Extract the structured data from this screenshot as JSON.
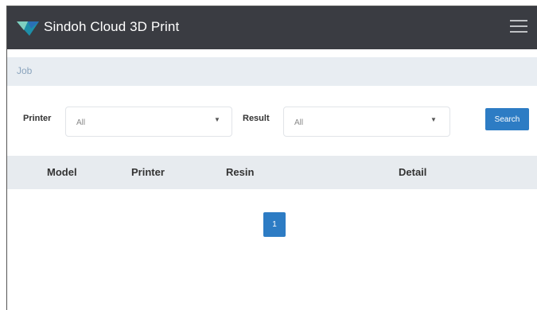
{
  "header": {
    "brand_title": "Sindoh Cloud 3D Print",
    "logo_icon": "sindoh-logo-icon",
    "menu_icon": "hamburger-menu-icon"
  },
  "breadcrumb": {
    "current": "Job"
  },
  "filters": {
    "printer": {
      "label": "Printer",
      "value": "All"
    },
    "result": {
      "label": "Result",
      "value": "All"
    },
    "search_label": "Search"
  },
  "table": {
    "columns": [
      "Model",
      "Printer",
      "Resin",
      "Detail"
    ]
  },
  "pagination": {
    "current_page": "1"
  },
  "colors": {
    "header_bg": "#3a3c42",
    "accent": "#2d7cc4",
    "breadcrumb_bg": "#e8edf2",
    "table_header_bg": "#e7ebef"
  }
}
